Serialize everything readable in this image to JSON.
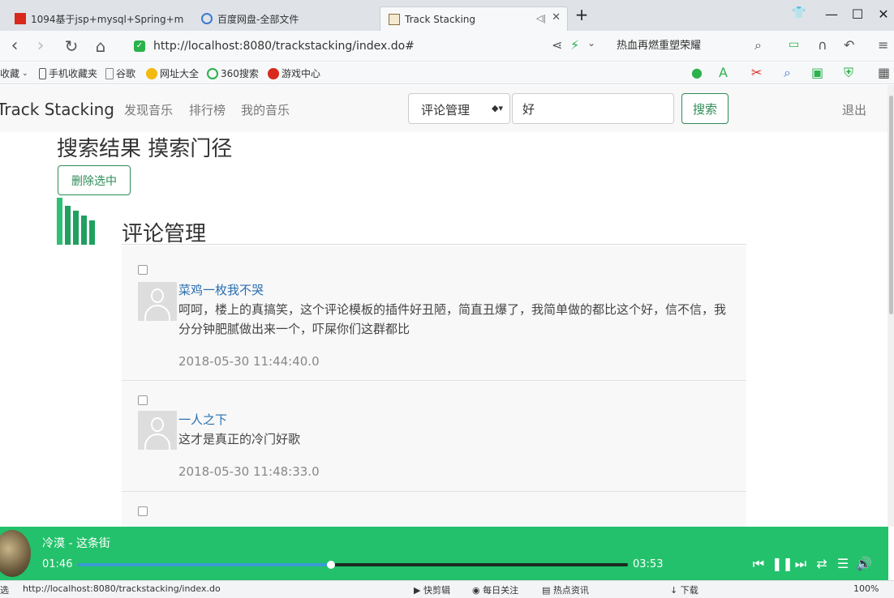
{
  "browser": {
    "tabs": [
      {
        "title": "1094基于jsp+mysql+Spring+m"
      },
      {
        "title": "百度网盘-全部文件"
      },
      {
        "title": "Track Stacking"
      }
    ],
    "new_tab": "+",
    "url": "http://localhost:8080/trackstacking/index.do#",
    "search_text": "热血再燃重塑荣耀",
    "bookmarks": [
      "收藏",
      "手机收藏夹",
      "谷歌",
      "网址大全",
      "360搜索",
      "游戏中心"
    ],
    "status_url": "http://localhost:8080/trackstacking/index.do",
    "status_left": "选",
    "status_items": [
      "快剪辑",
      "每日关注",
      "热点资讯",
      "下载"
    ],
    "zoom": "100%"
  },
  "app": {
    "brand": "Track Stacking",
    "nav": [
      "发现音乐",
      "排行榜",
      "我的音乐"
    ],
    "search_category": "评论管理",
    "search_value": "好",
    "search_button": "搜索",
    "logout": "退出"
  },
  "main": {
    "result_title": "搜索结果 摸索门径",
    "delete_button": "删除选中",
    "section_title": "评论管理",
    "comments": [
      {
        "user": "菜鸡一枚我不哭",
        "text": "呵呵，楼上的真搞笑，这个评论模板的插件好丑陋，简直丑爆了，我简单做的都比这个好，信不信，我分分钟肥腻做出来一个，吓屎你们这群都比",
        "time": "2018-05-30 11:44:40.0"
      },
      {
        "user": "一人之下",
        "text": "这才是真正的冷门好歌",
        "time": "2018-05-30 11:48:33.0"
      },
      {
        "user": "",
        "text": "",
        "time": ""
      }
    ]
  },
  "player": {
    "song": "冷漠 - 这条街",
    "current_time": "01:46",
    "total_time": "03:53",
    "progress": 0.46
  }
}
